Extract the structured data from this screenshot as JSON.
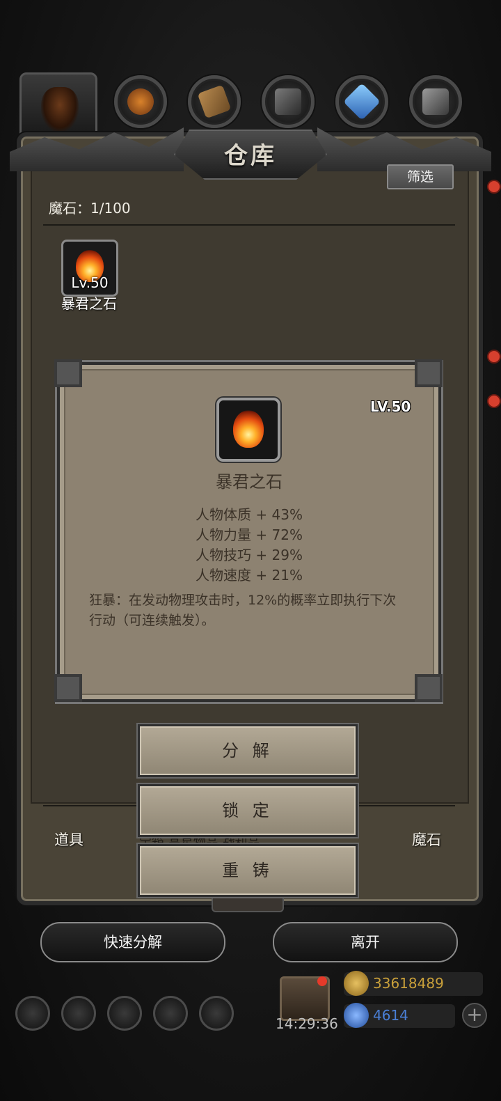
{
  "window": {
    "title": "仓库"
  },
  "toolbar": {
    "filter_label": "筛选"
  },
  "inventory": {
    "capacity_label": "魔石：1/100",
    "items": [
      {
        "name": "暴君之石",
        "level": "Lv.50",
        "icon": "flame-stone-icon"
      }
    ]
  },
  "detail": {
    "level": "LV.50",
    "name": "暴君之石",
    "stats": [
      "人物体质 + 43%",
      "人物力量 + 72%",
      "人物技巧 + 29%",
      "人物速度 + 21%"
    ],
    "description": "狂暴：在发动物理攻击时，12%的概率立即执行下次行动（可连续触发）。",
    "actions": [
      "分 解",
      "锁 定",
      "重 铸"
    ]
  },
  "bottom_tabs": {
    "left": "道具",
    "right": "魔石",
    "middle_partial": "宝箱    高星物品    战利品"
  },
  "bottom_buttons": {
    "quick_decompose": "快速分解",
    "leave": "离开"
  },
  "status": {
    "time": "14:29:36",
    "gold": "33618489",
    "gems": "4614"
  },
  "colors": {
    "panel": "#4a4437",
    "popup": "#8d8271",
    "gold_text": "#c9a03a",
    "gem_text": "#4a7fd6",
    "badge_red": "#e53a2a"
  }
}
